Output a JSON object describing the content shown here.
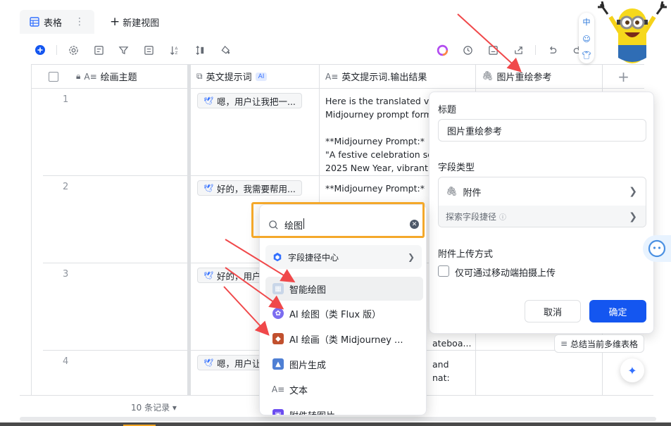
{
  "tabs": {
    "active": "表格",
    "more": "⋮",
    "new_view": "新建视图"
  },
  "columns": [
    {
      "title": "绘画主题"
    },
    {
      "title": "英文提示词",
      "badge": "AI"
    },
    {
      "title": "英文提示词.输出结果"
    },
    {
      "title": "图片重绘参考"
    }
  ],
  "rows": [
    {
      "num": "1",
      "prompt_chip": "嗯，用户让我把一...",
      "output": "Here is the translated ve\nMidjourney prompt form\n\n**Midjourney Prompt:*\n\"A festive celebration sc\n2025 New Year, vibrant"
    },
    {
      "num": "2",
      "prompt_chip": "好的，我需要帮用...",
      "output": "**Midjourney Prompt:*"
    },
    {
      "num": "3",
      "prompt_chip": "好的，用户",
      "output": "ateboa..."
    },
    {
      "num": "4",
      "prompt_chip": "嗯，用户让",
      "output": "and\nnat:"
    }
  ],
  "footer": {
    "record_count": "10 条记录"
  },
  "panel": {
    "title_label": "标题",
    "title_value": "图片重绘参考",
    "type_label": "字段类型",
    "type_value": "附件",
    "explore_label": "探索字段捷径",
    "upload_label": "附件上传方式",
    "upload_option": "仅可通过移动端拍摄上传",
    "cancel": "取消",
    "confirm": "确定"
  },
  "dropdown": {
    "search_value": "绘图",
    "center_label": "字段捷径中心",
    "options": [
      "智能绘图",
      "AI 绘图（类 Flux 版）",
      "AI 绘画（类 Midjourney ...",
      "图片生成",
      "文本",
      "附件转图片"
    ]
  },
  "summary_button": "总结当前多维表格",
  "ime": {
    "lang": "中"
  },
  "accent_color": "#1456f0",
  "highlight_color": "#f4a82a"
}
